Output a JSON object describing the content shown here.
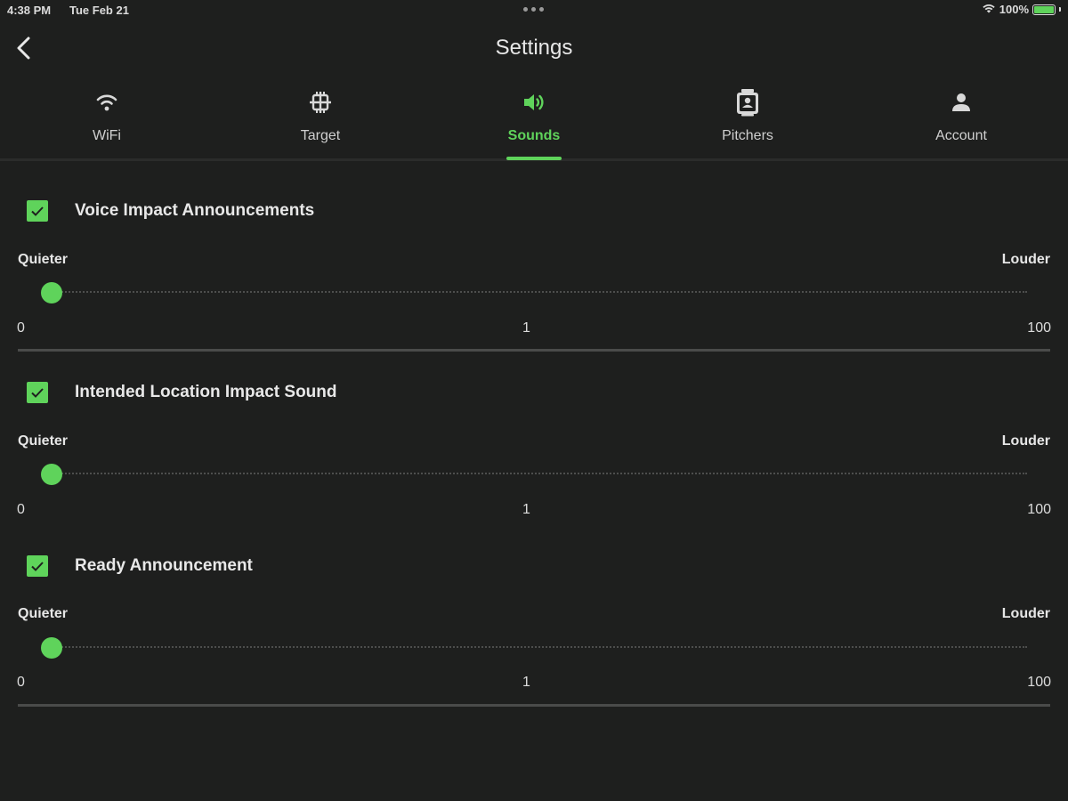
{
  "status_bar": {
    "time": "4:38 PM",
    "date": "Tue Feb 21",
    "battery": "100%"
  },
  "header": {
    "title": "Settings",
    "back_icon": "chevron-left-icon"
  },
  "tabs": [
    {
      "label": "WiFi",
      "icon": "wifi-icon",
      "active": false
    },
    {
      "label": "Target",
      "icon": "target-icon",
      "active": false
    },
    {
      "label": "Sounds",
      "icon": "speaker-icon",
      "active": true
    },
    {
      "label": "Pitchers",
      "icon": "pitcher-icon",
      "active": false
    },
    {
      "label": "Account",
      "icon": "person-icon",
      "active": false
    }
  ],
  "sounds": [
    {
      "label": "Voice Impact Announcements",
      "checked": true,
      "min_label": "Quieter",
      "max_label": "Louder",
      "tick_min": "0",
      "tick_value": "1",
      "tick_max": "100",
      "value": 1
    },
    {
      "label": "Intended Location Impact Sound",
      "checked": true,
      "min_label": "Quieter",
      "max_label": "Louder",
      "tick_min": "0",
      "tick_value": "1",
      "tick_max": "100",
      "value": 1
    },
    {
      "label": "Ready Announcement",
      "checked": true,
      "min_label": "Quieter",
      "max_label": "Louder",
      "tick_min": "0",
      "tick_value": "1",
      "tick_max": "100",
      "value": 1
    }
  ],
  "colors": {
    "accent": "#5fd35b",
    "background": "#1e1f1e",
    "text": "#e6e6e6"
  }
}
